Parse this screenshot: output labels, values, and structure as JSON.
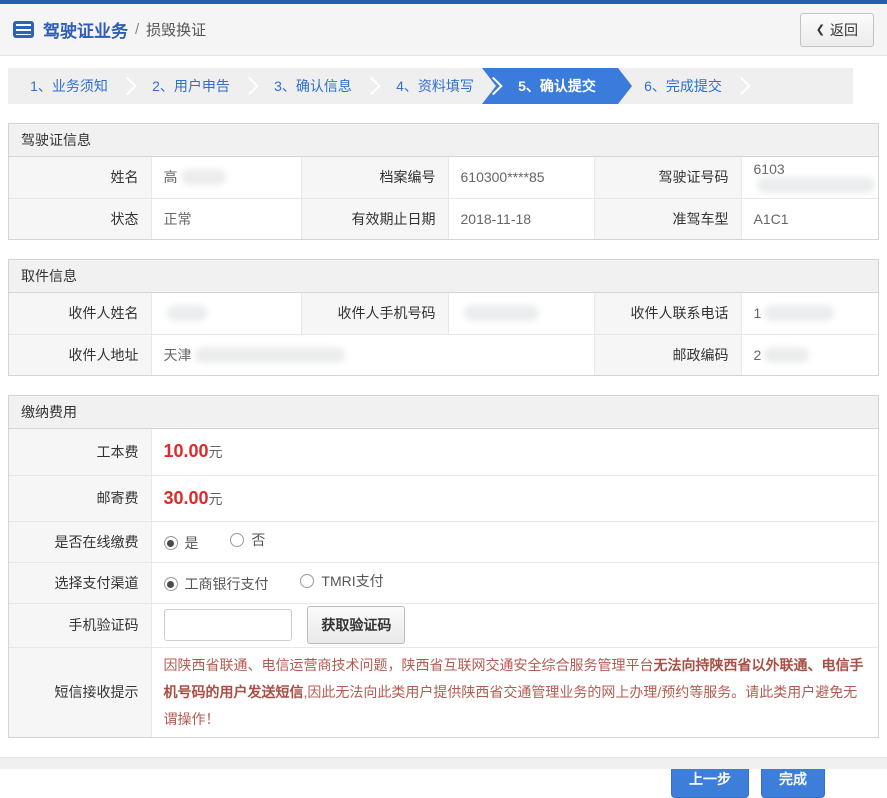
{
  "colors": {
    "accent_blue": "#3a7bdb",
    "title_blue": "#2e5cb8",
    "price_red": "#e02a2a",
    "notice_red": "#b35b51"
  },
  "header": {
    "title": "驾驶证业务",
    "separator": "/",
    "subtitle": "损毁换证",
    "back_icon": "❮",
    "back_label": "返回"
  },
  "steps": {
    "active_index": 4,
    "items": [
      {
        "label": "1、业务须知"
      },
      {
        "label": "2、用户申告"
      },
      {
        "label": "3、确认信息"
      },
      {
        "label": "4、资料填写"
      },
      {
        "label": "5、确认提交"
      },
      {
        "label": "6、完成提交"
      }
    ]
  },
  "license": {
    "title": "驾驶证信息",
    "name_label": "姓名",
    "name_value": "高",
    "file_no_label": "档案编号",
    "file_no_value": "610300****85",
    "license_no_label": "驾驶证号码",
    "license_no_value": "6103",
    "status_label": "状态",
    "status_value": "正常",
    "expiry_label": "有效期止日期",
    "expiry_value": "2018-11-18",
    "vehicle_label": "准驾车型",
    "vehicle_value": "A1C1"
  },
  "pickup": {
    "title": "取件信息",
    "recipient_name_label": "收件人姓名",
    "recipient_phone_label": "收件人手机号码",
    "recipient_tel_label": "收件人联系电话",
    "recipient_tel_value": "1",
    "address_label": "收件人地址",
    "address_value": "天津",
    "postal_label": "邮政编码",
    "postal_value": "2"
  },
  "payment": {
    "title": "缴纳费用",
    "production_fee_label": "工本费",
    "production_fee_value": "10.00",
    "postage_fee_label": "邮寄费",
    "postage_fee_value": "30.00",
    "fee_unit": "元",
    "online_pay_label": "是否在线缴费",
    "option_yes": "是",
    "option_no": "否",
    "channel_label": "选择支付渠道",
    "channel_icbc": "工商银行支付",
    "channel_tmri": "TMRI支付",
    "captcha_label": "手机验证码",
    "captcha_input_value": "",
    "get_captcha_button": "获取验证码",
    "sms_label": "短信接收提示",
    "sms_text_part1": "因陕西省联通、电信运营商技术问题，陕西省互联网交通安全综合服务管理平台",
    "sms_text_bold": "无法向持陕西省以外联通、电信手机号码的用户发送短信",
    "sms_text_part2": ",因此无法向此类用户提供陕西省交通管理业务的网上办理/预约等服务。请此类用户避免无谓操作！"
  },
  "footer": {
    "prev_button": "上一步",
    "finish_button": "完成"
  }
}
